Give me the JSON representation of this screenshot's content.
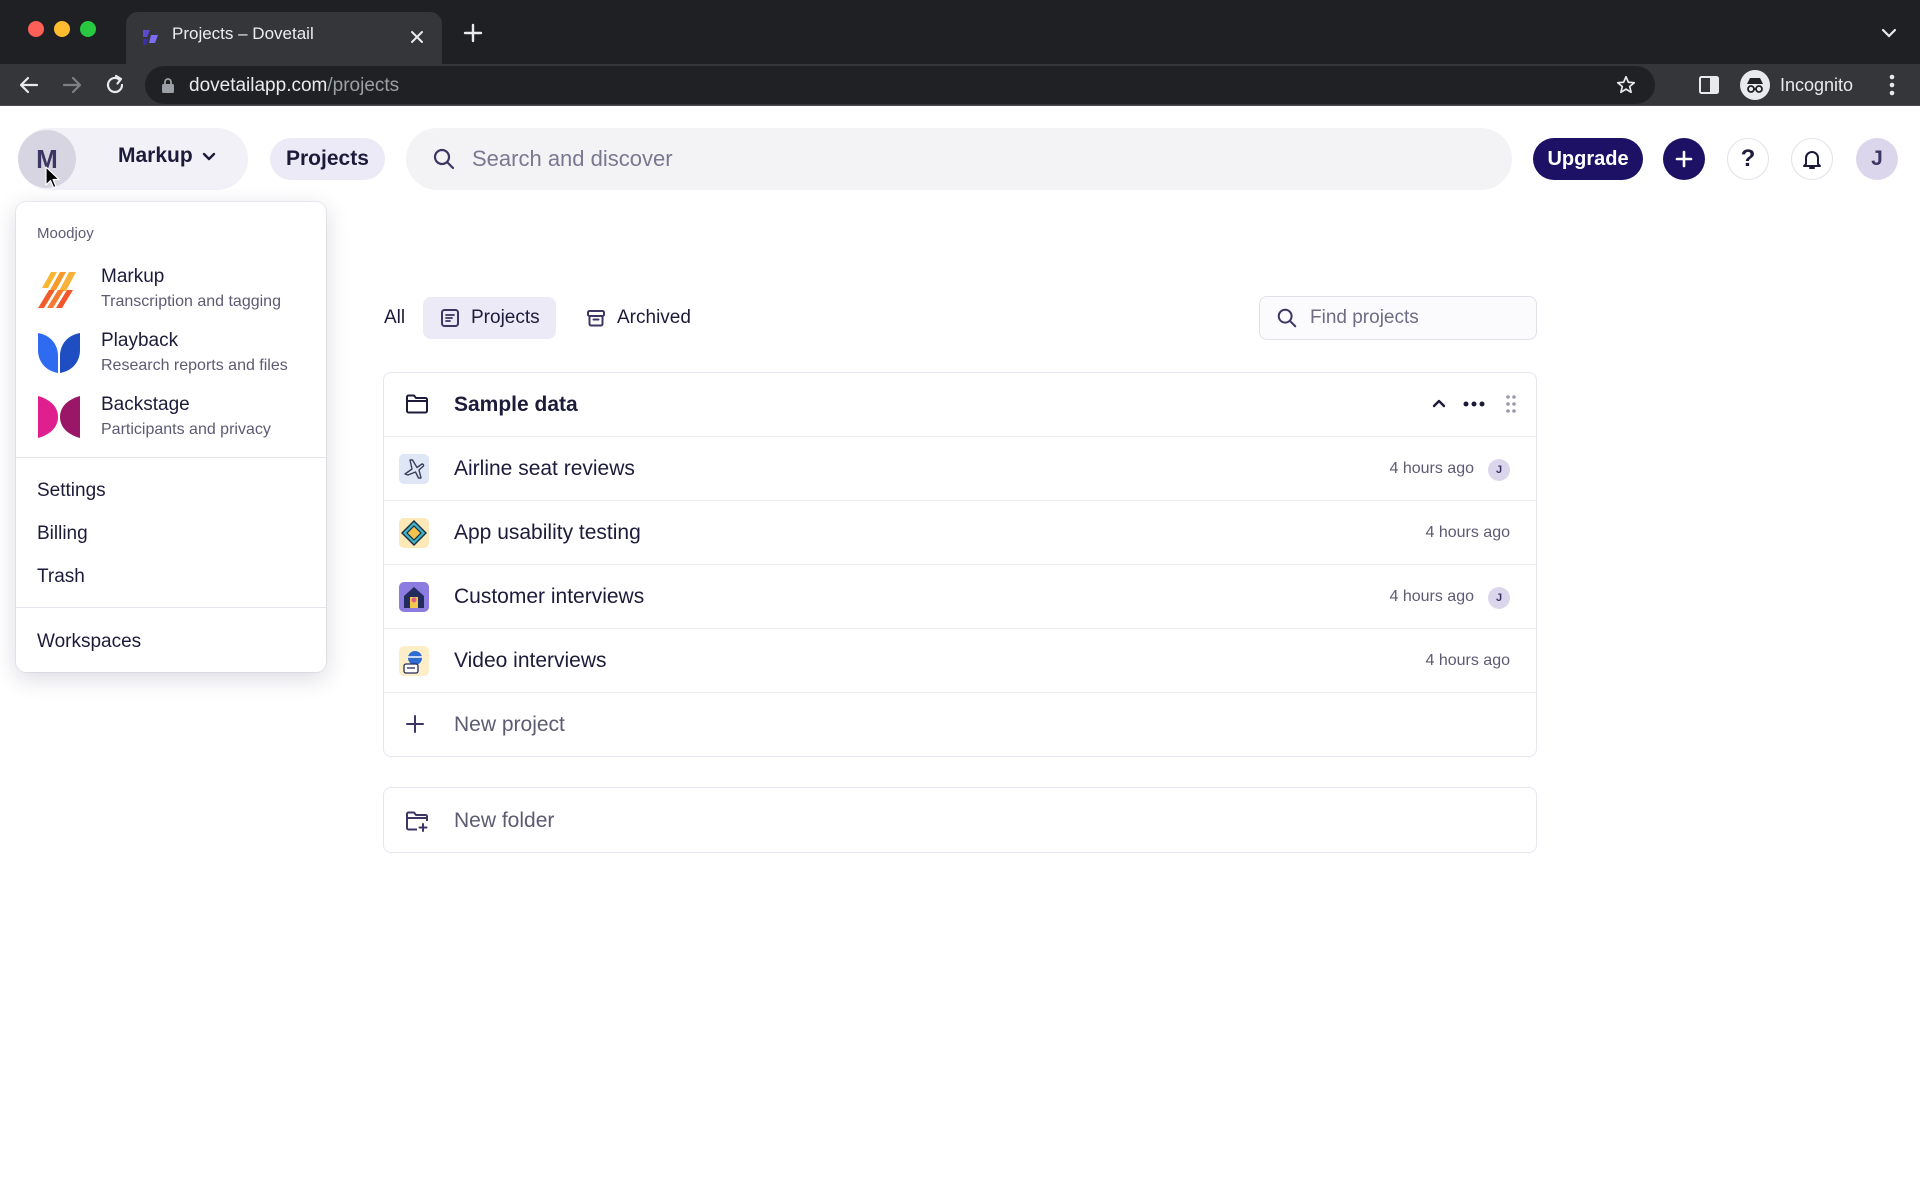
{
  "browser": {
    "tab_title": "Projects – Dovetail",
    "url_host": "dovetailapp.com",
    "url_path": "/projects",
    "profile_label": "Incognito"
  },
  "header": {
    "workspace_initial": "M",
    "workspace_name": "Markup",
    "projects_label": "Projects",
    "search_placeholder": "Search and discover",
    "upgrade_label": "Upgrade",
    "help_label": "?",
    "user_initial": "J",
    "accent_color": "#1d1166"
  },
  "dropdown": {
    "org_name": "Moodjoy",
    "apps": [
      {
        "name": "Markup",
        "description": "Transcription and tagging",
        "icon": "markup-logo-icon"
      },
      {
        "name": "Playback",
        "description": "Research reports and files",
        "icon": "playback-logo-icon"
      },
      {
        "name": "Backstage",
        "description": "Participants and privacy",
        "icon": "backstage-logo-icon"
      }
    ],
    "links": [
      "Settings",
      "Billing",
      "Trash"
    ],
    "footer_link": "Workspaces"
  },
  "filters": {
    "all_label": "All",
    "projects_label": "Projects",
    "archived_label": "Archived",
    "find_placeholder": "Find projects"
  },
  "folder": {
    "name": "Sample data",
    "projects": [
      {
        "title": "Airline seat reviews",
        "time": "4 hours ago",
        "avatar": "J",
        "icon": "airplane-icon"
      },
      {
        "title": "App usability testing",
        "time": "4 hours ago",
        "avatar": "",
        "icon": "tag-icon"
      },
      {
        "title": "Customer interviews",
        "time": "4 hours ago",
        "avatar": "J",
        "icon": "house-icon"
      },
      {
        "title": "Video interviews",
        "time": "4 hours ago",
        "avatar": "",
        "icon": "person-icon"
      }
    ],
    "new_project_label": "New project"
  },
  "new_folder_label": "New folder"
}
